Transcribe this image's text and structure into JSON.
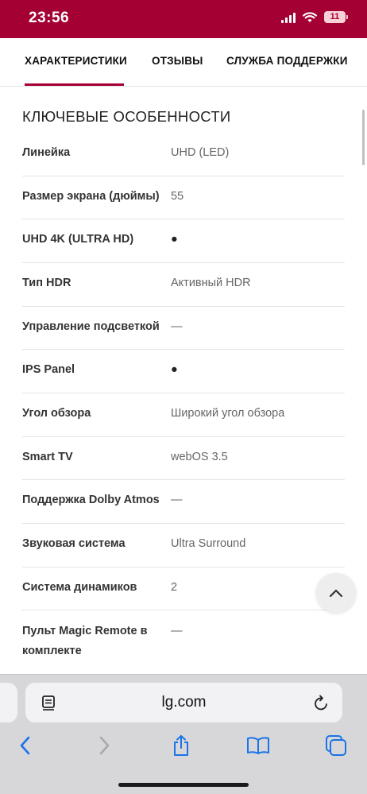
{
  "status_bar": {
    "time": "23:56",
    "battery_level": "11",
    "accent": "#a50034"
  },
  "tabs": [
    {
      "label": "ХАРАКТЕРИСТИКИ",
      "active": true
    },
    {
      "label": "ОТЗЫВЫ",
      "active": false
    },
    {
      "label": "СЛУЖБА ПОДДЕРЖКИ",
      "active": false
    }
  ],
  "section": {
    "title": "КЛЮЧЕВЫЕ ОСОБЕННОСТИ"
  },
  "specs": [
    {
      "label": "Линейка",
      "value": "UHD (LED)"
    },
    {
      "label": "Размер экрана (дюймы)",
      "value": "55"
    },
    {
      "label": "UHD 4K (ULTRA HD)",
      "value": "●"
    },
    {
      "label": "Тип HDR",
      "value": "Активный HDR"
    },
    {
      "label": "Управление подсветкой",
      "value": "—"
    },
    {
      "label": "IPS Panel",
      "value": "●"
    },
    {
      "label": "Угол обзора",
      "value": "Широкий угол обзора"
    },
    {
      "label": "Smart TV",
      "value": "webOS 3.5"
    },
    {
      "label": "Поддержка Dolby Atmos",
      "value": "—"
    },
    {
      "label": "Звуковая система",
      "value": "Ultra Surround"
    },
    {
      "label": "Система динамиков",
      "value": "2"
    },
    {
      "label": "Пульт Magic Remote в комплекте",
      "value": "—"
    }
  ],
  "browser": {
    "url": "lg.com",
    "icons": [
      "reader-icon",
      "reload-icon",
      "back-icon",
      "forward-icon",
      "share-icon",
      "bookmarks-icon",
      "tabs-icon"
    ]
  }
}
